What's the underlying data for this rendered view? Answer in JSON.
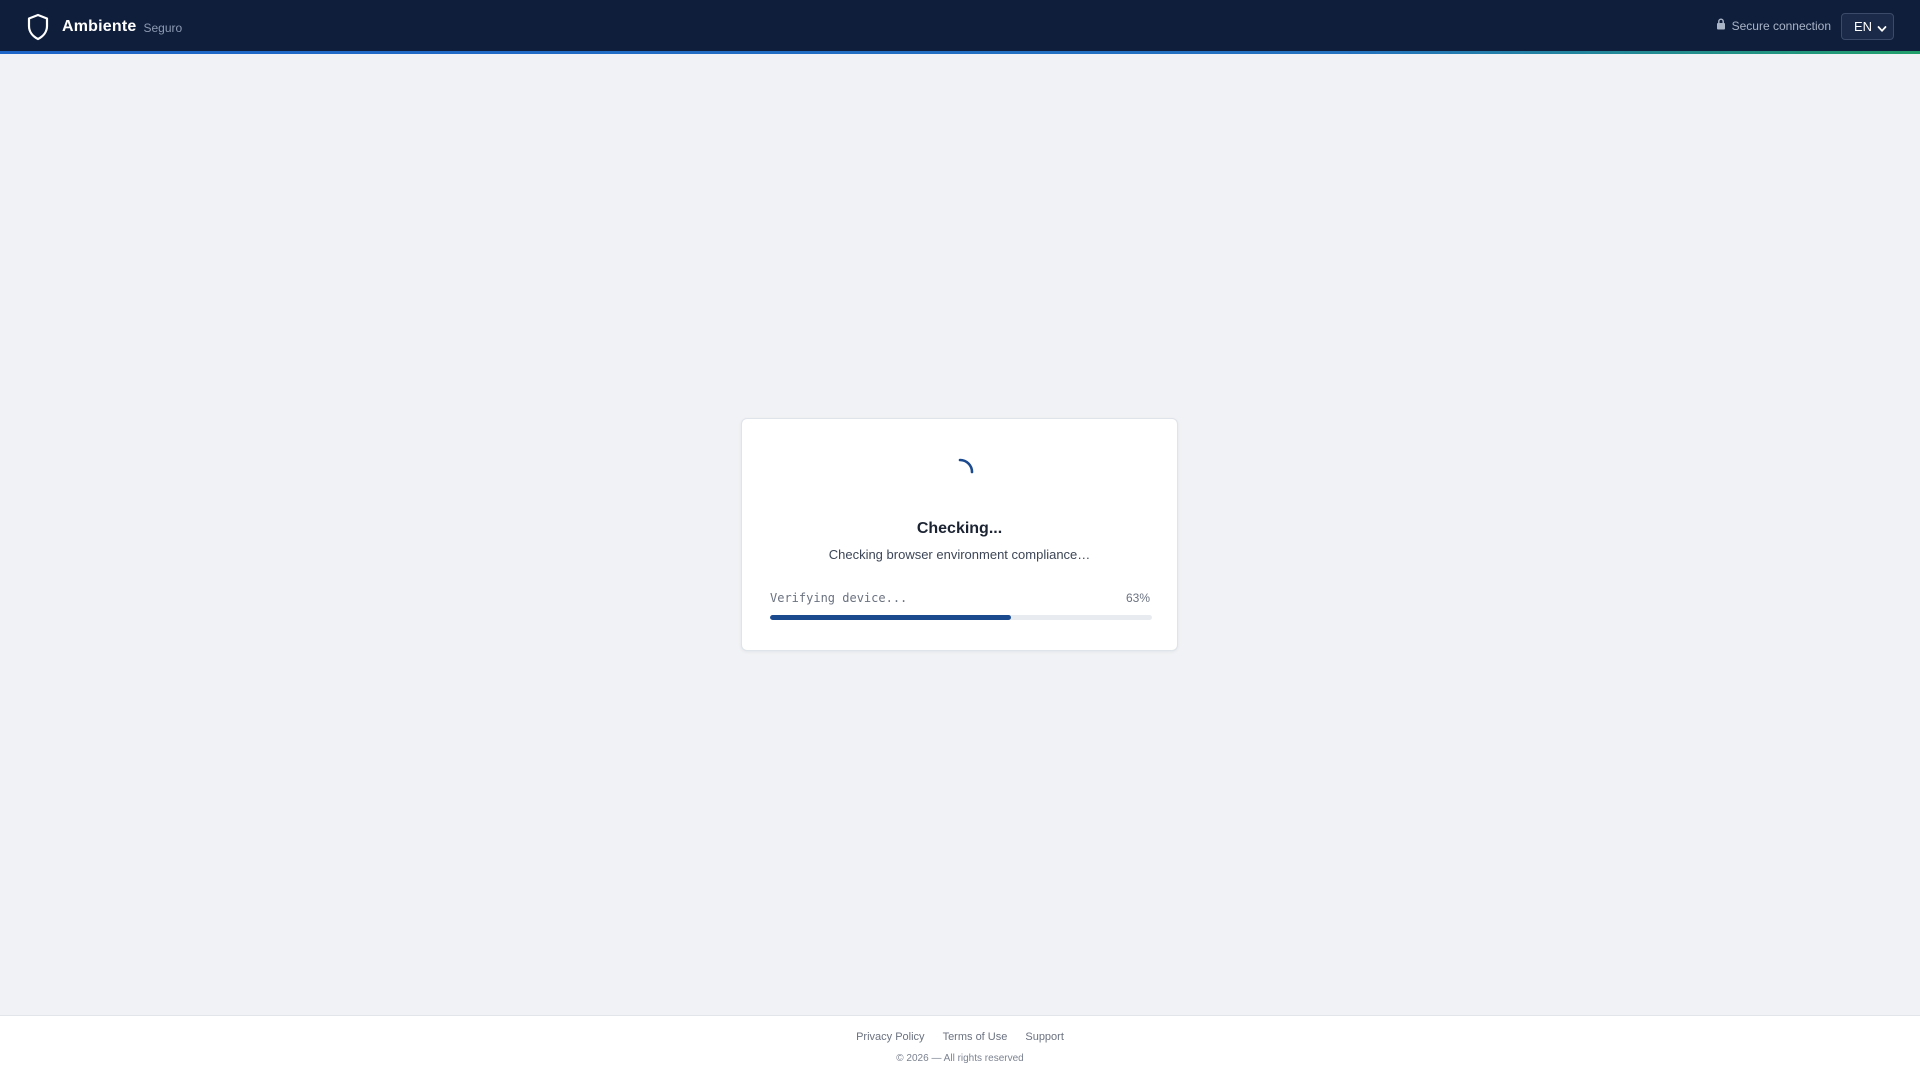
{
  "header": {
    "brand_name": "Ambiente",
    "brand_sub": "Seguro",
    "secure_label": "Secure connection",
    "language": "EN"
  },
  "card": {
    "title": "Checking...",
    "subtitle": "Checking browser environment compliance…",
    "progress_label": "Verifying device...",
    "progress_text": "63%",
    "progress_value": 0.63
  },
  "footer": {
    "links": [
      "Privacy Policy",
      "Terms of Use",
      "Support"
    ],
    "copyright": "© 2026 — All rights reserved"
  },
  "colors": {
    "header_bg": "#0f1e3b",
    "progress_fill": "#1c4a8f",
    "accent_green": "#22a06b"
  },
  "icons": {
    "brand": "shield-icon",
    "secure": "lock-icon",
    "language": "chevron-down-icon",
    "loading": "spinner-icon"
  }
}
